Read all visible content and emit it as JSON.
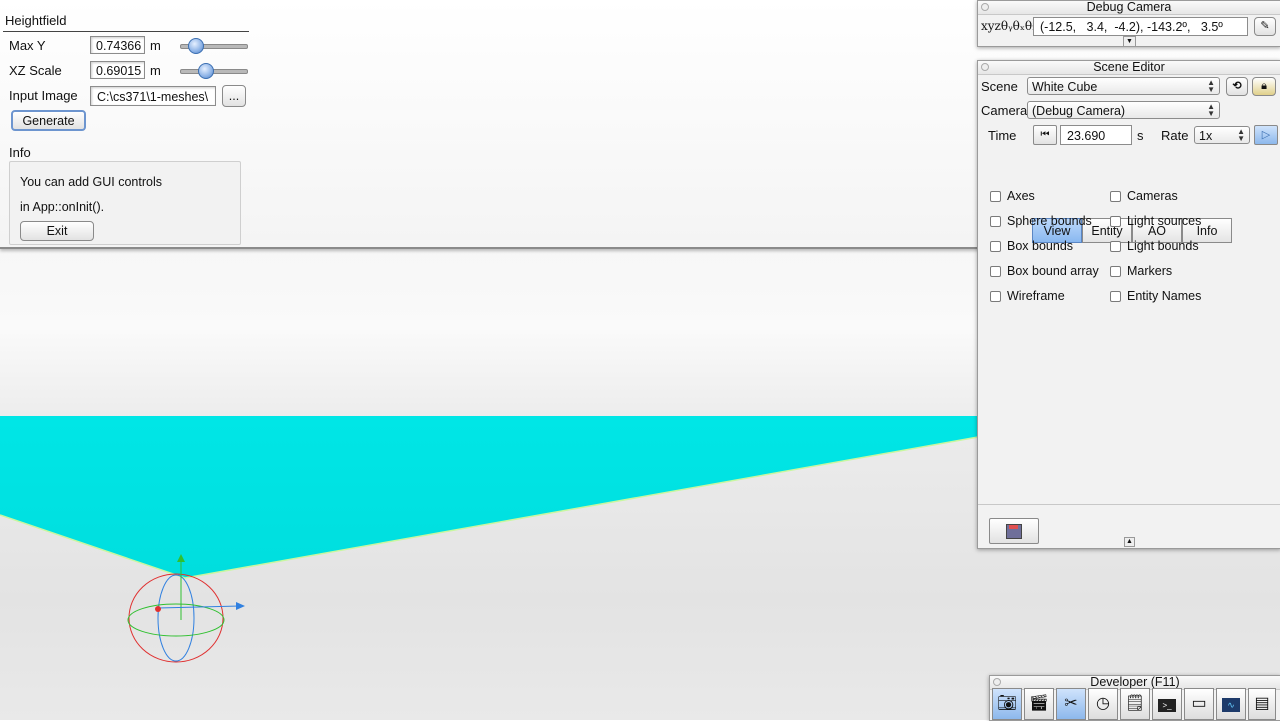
{
  "heightfield": {
    "title": "Heightfield",
    "max_y": {
      "label": "Max Y",
      "value": "0.74366",
      "unit": "m",
      "slider_fraction": 0.16
    },
    "xz_scale": {
      "label": "XZ Scale",
      "value": "0.69015",
      "unit": "m",
      "slider_fraction": 0.35
    },
    "input_image": {
      "label": "Input Image",
      "value": "C:\\cs371\\1-meshes\\",
      "browse_label": "..."
    },
    "generate_label": "Generate",
    "info": {
      "label": "Info",
      "line1": "You can add GUI controls",
      "line2": "in App::onInit().",
      "exit_label": "Exit"
    }
  },
  "debug_camera": {
    "title": "Debug Camera",
    "coords_label": "xyzθᵧθₓθ₂",
    "coords_value": "(-12.5,   3.4,  -4.2), -143.2º,   3.5º",
    "expand_icon": "▼"
  },
  "scene_editor": {
    "title": "Scene Editor",
    "scene_label": "Scene",
    "scene_value": "White Cube",
    "camera_label": "Camera",
    "camera_value": "(Debug Camera)",
    "time_label": "Time",
    "time_value": "23.690",
    "time_unit": "s",
    "rate_label": "Rate",
    "rate_value": "1x",
    "tabs": [
      "View",
      "Entity",
      "AO",
      "Info"
    ],
    "active_tab": "View",
    "checkboxes_left": [
      "Axes",
      "Sphere bounds",
      "Box bounds",
      "Box bound array",
      "Wireframe"
    ],
    "checkboxes_right": [
      "Cameras",
      "Light sources",
      "Light bounds",
      "Markers",
      "Entity Names"
    ],
    "collapse_icon": "▲"
  },
  "developer": {
    "title": "Developer (F11)",
    "tools": [
      "camera-icon",
      "clapperboard-icon",
      "tools-icon",
      "clock-icon",
      "note-icon",
      "terminal-icon",
      "windows-icon",
      "profiler-icon",
      "document-icon"
    ]
  },
  "colors": {
    "accent": "#89b8f0",
    "ground_cyan": "#00e5e5",
    "axis_x": "#e03030",
    "axis_y": "#30c030",
    "axis_z": "#3080e0"
  }
}
